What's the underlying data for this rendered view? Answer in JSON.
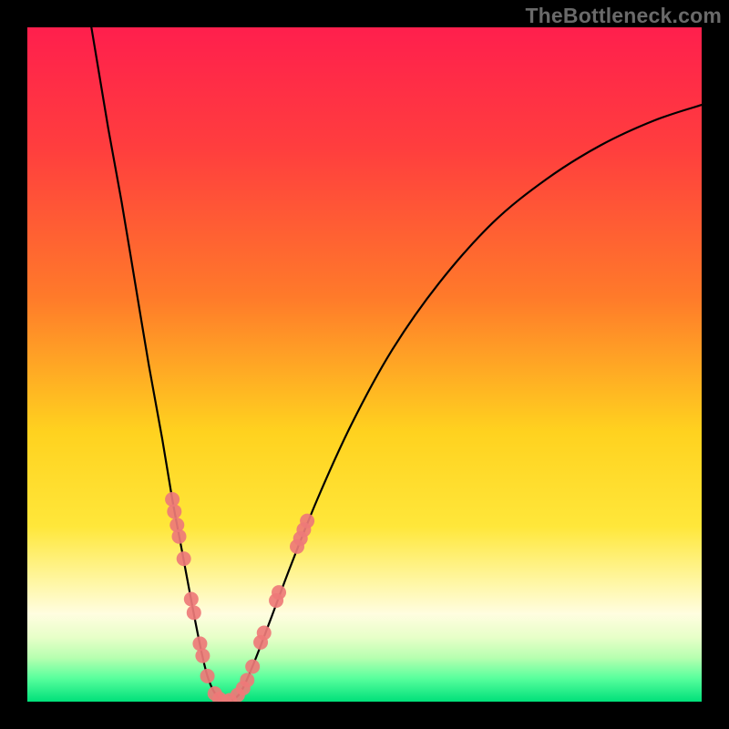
{
  "watermark": "TheBottleneck.com",
  "chart_data": {
    "type": "line",
    "title": "",
    "xlabel": "",
    "ylabel": "",
    "xlim": [
      0,
      1
    ],
    "ylim": [
      0,
      1
    ],
    "gradient_stops": [
      {
        "offset": 0,
        "color": "#ff1f4d"
      },
      {
        "offset": 0.18,
        "color": "#ff3e3e"
      },
      {
        "offset": 0.4,
        "color": "#ff7a2a"
      },
      {
        "offset": 0.6,
        "color": "#ffd21f"
      },
      {
        "offset": 0.74,
        "color": "#ffe73a"
      },
      {
        "offset": 0.82,
        "color": "#fff6a0"
      },
      {
        "offset": 0.87,
        "color": "#fffde0"
      },
      {
        "offset": 0.905,
        "color": "#e7ffc8"
      },
      {
        "offset": 0.935,
        "color": "#b7ffb0"
      },
      {
        "offset": 0.965,
        "color": "#59ff9d"
      },
      {
        "offset": 1.0,
        "color": "#00e07a"
      }
    ],
    "series": [
      {
        "name": "bottleneck-curve",
        "color": "#000000",
        "points": [
          {
            "x": 0.095,
            "y": 1.0
          },
          {
            "x": 0.105,
            "y": 0.94
          },
          {
            "x": 0.12,
            "y": 0.85
          },
          {
            "x": 0.14,
            "y": 0.74
          },
          {
            "x": 0.16,
            "y": 0.62
          },
          {
            "x": 0.18,
            "y": 0.5
          },
          {
            "x": 0.2,
            "y": 0.39
          },
          {
            "x": 0.215,
            "y": 0.3
          },
          {
            "x": 0.23,
            "y": 0.22
          },
          {
            "x": 0.245,
            "y": 0.14
          },
          {
            "x": 0.258,
            "y": 0.075
          },
          {
            "x": 0.268,
            "y": 0.035
          },
          {
            "x": 0.28,
            "y": 0.01
          },
          {
            "x": 0.295,
            "y": 0.0
          },
          {
            "x": 0.315,
            "y": 0.012
          },
          {
            "x": 0.335,
            "y": 0.055
          },
          {
            "x": 0.36,
            "y": 0.12
          },
          {
            "x": 0.39,
            "y": 0.2
          },
          {
            "x": 0.43,
            "y": 0.3
          },
          {
            "x": 0.48,
            "y": 0.41
          },
          {
            "x": 0.54,
            "y": 0.52
          },
          {
            "x": 0.61,
            "y": 0.62
          },
          {
            "x": 0.69,
            "y": 0.71
          },
          {
            "x": 0.77,
            "y": 0.775
          },
          {
            "x": 0.85,
            "y": 0.825
          },
          {
            "x": 0.93,
            "y": 0.862
          },
          {
            "x": 1.0,
            "y": 0.885
          }
        ]
      }
    ],
    "markers": {
      "color": "#ee7a78",
      "radius_px": 8,
      "points_xy": [
        [
          0.215,
          0.3
        ],
        [
          0.218,
          0.282
        ],
        [
          0.222,
          0.262
        ],
        [
          0.225,
          0.245
        ],
        [
          0.232,
          0.212
        ],
        [
          0.243,
          0.152
        ],
        [
          0.247,
          0.132
        ],
        [
          0.256,
          0.086
        ],
        [
          0.26,
          0.068
        ],
        [
          0.267,
          0.038
        ],
        [
          0.278,
          0.012
        ],
        [
          0.285,
          0.004
        ],
        [
          0.293,
          0.0
        ],
        [
          0.3,
          0.002
        ],
        [
          0.312,
          0.01
        ],
        [
          0.32,
          0.02
        ],
        [
          0.326,
          0.032
        ],
        [
          0.334,
          0.052
        ],
        [
          0.346,
          0.088
        ],
        [
          0.351,
          0.102
        ],
        [
          0.369,
          0.15
        ],
        [
          0.373,
          0.162
        ],
        [
          0.4,
          0.23
        ],
        [
          0.405,
          0.242
        ],
        [
          0.41,
          0.255
        ],
        [
          0.415,
          0.268
        ]
      ]
    }
  }
}
